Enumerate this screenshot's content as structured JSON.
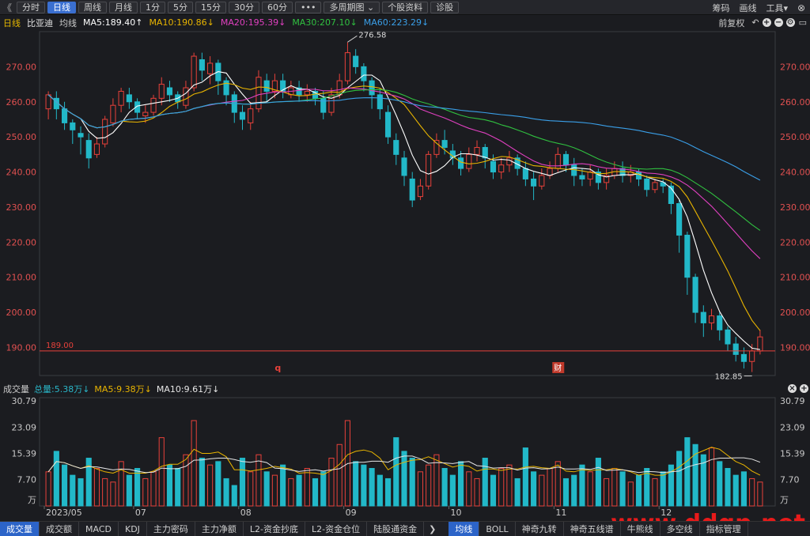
{
  "toolbar": {
    "back": "《",
    "tabs": [
      "分时",
      "日线",
      "周线",
      "月线",
      "1分",
      "5分",
      "15分",
      "30分",
      "60分",
      "•••",
      "多周期图 ⌄",
      "个股资料",
      "诊股"
    ],
    "active_tab": 1,
    "right_links": [
      "筹码",
      "画线",
      "工具▾"
    ],
    "close": "⊗"
  },
  "legend": {
    "period": "日线",
    "stock": "比亚迪",
    "ma_label": "均线",
    "ma": [
      {
        "label": "MA5:189.40↑",
        "color": "#ffffff"
      },
      {
        "label": "MA10:190.86↓",
        "color": "#e8b400"
      },
      {
        "label": "MA20:195.39↓",
        "color": "#e040c0"
      },
      {
        "label": "MA30:207.10↓",
        "color": "#30c040"
      },
      {
        "label": "MA60:223.29↓",
        "color": "#3a9fe8"
      }
    ],
    "right_text": "前复权"
  },
  "volume_legend": {
    "label": "成交量",
    "total": "总量:5.38万↓",
    "ma5": "MA5:9.38万↓",
    "ma10": "MA10:9.61万↓"
  },
  "bottom_tabs": [
    "成交量",
    "成交额",
    "MACD",
    "KDJ",
    "主力密码",
    "主力净额",
    "L2-资金抄底",
    "L2-资金仓位",
    "陆股通资金"
  ],
  "bottom_tabs2": [
    "均线",
    "BOLL",
    "神奇九转",
    "神奇五线谱",
    "牛熊线",
    "多空线",
    "指标管理"
  ],
  "watermark": "www.ddgp.net",
  "chart_data": {
    "type": "candlestick",
    "price_axis": [
      "270.00",
      "260.00",
      "250.00",
      "240.00",
      "230.00",
      "220.00",
      "210.00",
      "200.00",
      "190.00"
    ],
    "volume_axis": [
      "30.79",
      "23.09",
      "15.39",
      "7.70",
      "万"
    ],
    "x_labels": [
      "2023/05",
      "07",
      "08",
      "09",
      "10",
      "11",
      "12"
    ],
    "ylim": [
      182,
      280
    ],
    "high_mark": "276.58",
    "low_mark": "182.85",
    "ref_line": "189.00",
    "event_markers": [
      "q",
      "财"
    ],
    "candles": [
      [
        258,
        262,
        255,
        263
      ],
      [
        261,
        258,
        255,
        263
      ],
      [
        258,
        254,
        252,
        260
      ],
      [
        254,
        252,
        248,
        255
      ],
      [
        251,
        250,
        245,
        253
      ],
      [
        249,
        244,
        241,
        251
      ],
      [
        245,
        248,
        244,
        250
      ],
      [
        248,
        255,
        247,
        256
      ],
      [
        254,
        259,
        253,
        261
      ],
      [
        259,
        263,
        257,
        264
      ],
      [
        262,
        260,
        258,
        264
      ],
      [
        260,
        257,
        255,
        261
      ],
      [
        256,
        257,
        254,
        259
      ],
      [
        257,
        261,
        256,
        262
      ],
      [
        261,
        265,
        259,
        267
      ],
      [
        264,
        262,
        260,
        266
      ],
      [
        262,
        260,
        258,
        263
      ],
      [
        259,
        264,
        258,
        266
      ],
      [
        264,
        273,
        263,
        274
      ],
      [
        272,
        269,
        266,
        274
      ],
      [
        268,
        271,
        265,
        273
      ],
      [
        271,
        266,
        262,
        272
      ],
      [
        266,
        262,
        259,
        267
      ],
      [
        262,
        257,
        254,
        263
      ],
      [
        257,
        255,
        252,
        259
      ],
      [
        254,
        258,
        252,
        260
      ],
      [
        258,
        267,
        257,
        269
      ],
      [
        266,
        263,
        260,
        268
      ],
      [
        263,
        266,
        261,
        268
      ],
      [
        266,
        263,
        261,
        268
      ],
      [
        262,
        264,
        261,
        266
      ],
      [
        264,
        262,
        260,
        266
      ],
      [
        262,
        263,
        260,
        265
      ],
      [
        263,
        261,
        259,
        264
      ],
      [
        261,
        257,
        255,
        263
      ],
      [
        257,
        262,
        256,
        264
      ],
      [
        262,
        266,
        261,
        268
      ],
      [
        266,
        274,
        265,
        277
      ],
      [
        273,
        270,
        268,
        275
      ],
      [
        270,
        266,
        263,
        271
      ],
      [
        266,
        262,
        258,
        267
      ],
      [
        262,
        258,
        255,
        264
      ],
      [
        257,
        250,
        248,
        259
      ],
      [
        249,
        245,
        242,
        251
      ],
      [
        244,
        239,
        236,
        246
      ],
      [
        238,
        232,
        230,
        240
      ],
      [
        233,
        236,
        232,
        238
      ],
      [
        236,
        245,
        235,
        246
      ],
      [
        245,
        249,
        244,
        251
      ],
      [
        249,
        247,
        245,
        252
      ],
      [
        246,
        244,
        242,
        248
      ],
      [
        244,
        241,
        239,
        246
      ],
      [
        241,
        245,
        240,
        247
      ],
      [
        245,
        247,
        243,
        249
      ],
      [
        247,
        244,
        241,
        248
      ],
      [
        243,
        240,
        238,
        245
      ],
      [
        240,
        242,
        238,
        244
      ],
      [
        242,
        244,
        240,
        246
      ],
      [
        244,
        241,
        239,
        245
      ],
      [
        241,
        238,
        236,
        243
      ],
      [
        238,
        236,
        232,
        240
      ],
      [
        236,
        239,
        235,
        241
      ],
      [
        239,
        241,
        238,
        243
      ],
      [
        241,
        245,
        240,
        247
      ],
      [
        245,
        242,
        240,
        246
      ],
      [
        242,
        239,
        236,
        244
      ],
      [
        239,
        238,
        236,
        241
      ],
      [
        238,
        240,
        236,
        242
      ],
      [
        240,
        237,
        235,
        241
      ],
      [
        237,
        239,
        235,
        241
      ],
      [
        239,
        241,
        238,
        243
      ],
      [
        241,
        239,
        237,
        243
      ],
      [
        239,
        240,
        237,
        242
      ],
      [
        240,
        238,
        236,
        241
      ],
      [
        238,
        235,
        233,
        239
      ],
      [
        235,
        237,
        234,
        238
      ],
      [
        237,
        236,
        234,
        238
      ],
      [
        236,
        231,
        228,
        237
      ],
      [
        231,
        222,
        217,
        232
      ],
      [
        222,
        210,
        205,
        223
      ],
      [
        210,
        200,
        197,
        211
      ],
      [
        200,
        197,
        193,
        202
      ],
      [
        197,
        199,
        195,
        201
      ],
      [
        199,
        195,
        192,
        200
      ],
      [
        195,
        191,
        189,
        196
      ],
      [
        191,
        188,
        186,
        193
      ],
      [
        188,
        186,
        184,
        190
      ],
      [
        186,
        189,
        183,
        191
      ],
      [
        189,
        193,
        188,
        195
      ]
    ],
    "volumes": [
      10,
      16,
      12,
      9,
      8,
      14,
      11,
      8,
      7,
      13,
      9,
      11,
      8,
      10,
      20,
      12,
      11,
      15,
      25,
      14,
      12,
      13,
      8,
      6,
      14,
      10,
      15,
      10,
      9,
      12,
      8,
      9,
      11,
      8,
      10,
      14,
      18,
      25,
      13,
      12,
      11,
      9,
      8,
      20,
      16,
      14,
      10,
      12,
      15,
      11,
      9,
      13,
      10,
      8,
      14,
      9,
      11,
      12,
      8,
      17,
      10,
      9,
      11,
      13,
      8,
      9,
      12,
      10,
      14,
      8,
      11,
      10,
      7,
      9,
      11,
      8,
      10,
      12,
      16,
      20,
      18,
      15,
      17,
      13,
      11,
      9,
      10,
      8,
      7
    ],
    "series": [
      {
        "name": "MA5",
        "color": "#ffffff"
      },
      {
        "name": "MA10",
        "color": "#e8b400"
      },
      {
        "name": "MA20",
        "color": "#e040c0"
      },
      {
        "name": "MA30",
        "color": "#30c040"
      },
      {
        "name": "MA60",
        "color": "#3a9fe8"
      }
    ]
  }
}
